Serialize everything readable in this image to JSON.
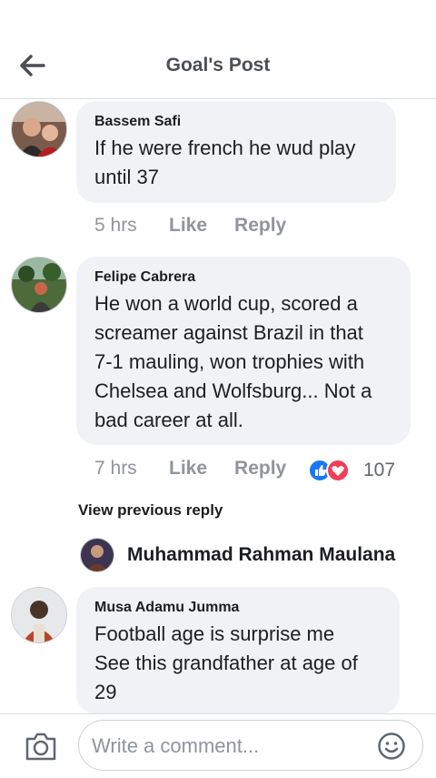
{
  "header": {
    "title": "Goal's Post"
  },
  "comments": [
    {
      "author": "Bassem Safi",
      "lines": [
        "If he were french he wud play",
        "until 37"
      ],
      "time": "5 hrs",
      "like": "Like",
      "reply": "Reply"
    },
    {
      "author": "Felipe Cabrera",
      "lines": [
        "He won a world cup, scored a",
        "screamer against Brazil in that",
        "7-1 mauling, won trophies with",
        "Chelsea and Wolfsburg... Not a",
        "bad career at all."
      ],
      "time": "7 hrs",
      "like": "Like",
      "reply": "Reply",
      "reaction_count": "107",
      "reaction_icons": [
        "like-icon",
        "love-icon"
      ]
    },
    {
      "author": "Musa Adamu Jumma",
      "lines": [
        "Football age is surprise me",
        "See this grandfather at age of",
        "29"
      ]
    }
  ],
  "replies": {
    "view_previous": "View previous reply",
    "reply_author": "Muhammad Rahman Maulana"
  },
  "composer": {
    "placeholder": "Write a comment..."
  },
  "colors": {
    "like_blue": "#1877f2",
    "love_red": "#f33e58",
    "meta_gray": "#90949c",
    "bubble": "#f0f2f5"
  }
}
